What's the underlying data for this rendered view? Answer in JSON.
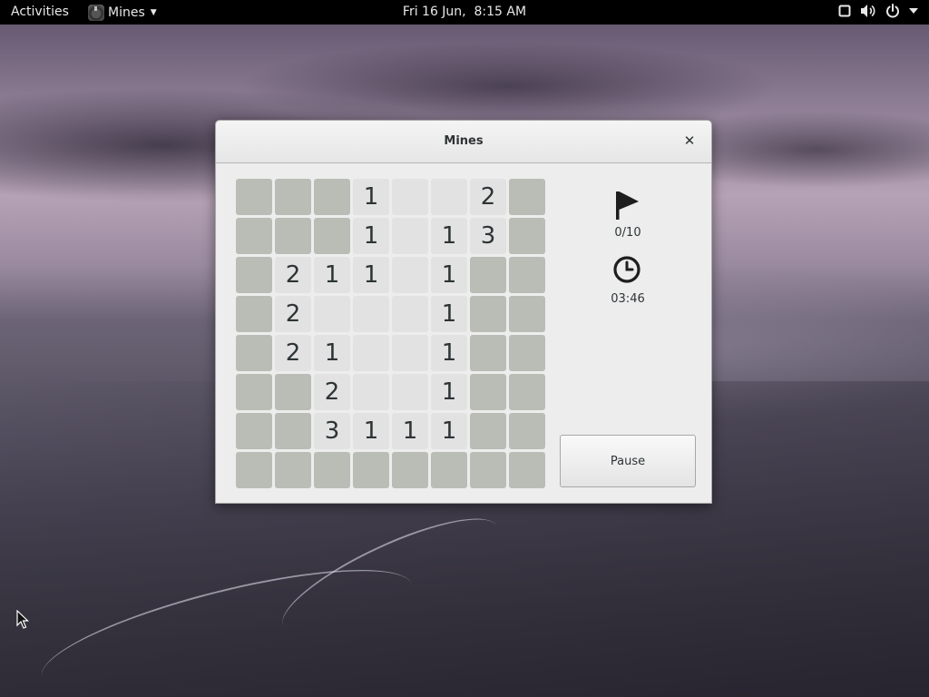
{
  "topbar": {
    "activities_label": "Activities",
    "app_name": "Mines",
    "clock": "Fri 16 Jun,  8:15 AM",
    "tray_icons": [
      "window-icon",
      "volume-icon",
      "power-icon",
      "chevron-down-icon"
    ]
  },
  "window": {
    "title": "Mines",
    "close_symbol": "✕"
  },
  "grid": {
    "columns": 8,
    "rows": [
      [
        {
          "s": "covered",
          "v": ""
        },
        {
          "s": "covered",
          "v": ""
        },
        {
          "s": "covered",
          "v": ""
        },
        {
          "s": "cleared",
          "v": "1"
        },
        {
          "s": "cleared",
          "v": ""
        },
        {
          "s": "cleared",
          "v": ""
        },
        {
          "s": "cleared",
          "v": "2"
        },
        {
          "s": "covered",
          "v": ""
        }
      ],
      [
        {
          "s": "covered",
          "v": ""
        },
        {
          "s": "covered",
          "v": ""
        },
        {
          "s": "covered",
          "v": ""
        },
        {
          "s": "cleared",
          "v": "1"
        },
        {
          "s": "cleared",
          "v": ""
        },
        {
          "s": "cleared",
          "v": "1"
        },
        {
          "s": "cleared",
          "v": "3"
        },
        {
          "s": "covered",
          "v": ""
        }
      ],
      [
        {
          "s": "covered",
          "v": ""
        },
        {
          "s": "cleared",
          "v": "2"
        },
        {
          "s": "cleared",
          "v": "1"
        },
        {
          "s": "cleared",
          "v": "1"
        },
        {
          "s": "cleared",
          "v": ""
        },
        {
          "s": "cleared",
          "v": "1"
        },
        {
          "s": "covered",
          "v": ""
        },
        {
          "s": "covered",
          "v": ""
        }
      ],
      [
        {
          "s": "covered",
          "v": ""
        },
        {
          "s": "cleared",
          "v": "2"
        },
        {
          "s": "cleared",
          "v": ""
        },
        {
          "s": "cleared",
          "v": ""
        },
        {
          "s": "cleared",
          "v": ""
        },
        {
          "s": "cleared",
          "v": "1"
        },
        {
          "s": "covered",
          "v": ""
        },
        {
          "s": "covered",
          "v": ""
        }
      ],
      [
        {
          "s": "covered",
          "v": ""
        },
        {
          "s": "cleared",
          "v": "2"
        },
        {
          "s": "cleared",
          "v": "1"
        },
        {
          "s": "cleared",
          "v": ""
        },
        {
          "s": "cleared",
          "v": ""
        },
        {
          "s": "cleared",
          "v": "1"
        },
        {
          "s": "covered",
          "v": ""
        },
        {
          "s": "covered",
          "v": ""
        }
      ],
      [
        {
          "s": "covered",
          "v": ""
        },
        {
          "s": "covered",
          "v": ""
        },
        {
          "s": "cleared",
          "v": "2"
        },
        {
          "s": "cleared",
          "v": ""
        },
        {
          "s": "cleared",
          "v": ""
        },
        {
          "s": "cleared",
          "v": "1"
        },
        {
          "s": "covered",
          "v": ""
        },
        {
          "s": "covered",
          "v": ""
        }
      ],
      [
        {
          "s": "covered",
          "v": ""
        },
        {
          "s": "covered",
          "v": ""
        },
        {
          "s": "cleared",
          "v": "3"
        },
        {
          "s": "cleared",
          "v": "1"
        },
        {
          "s": "cleared",
          "v": "1"
        },
        {
          "s": "cleared",
          "v": "1"
        },
        {
          "s": "covered",
          "v": ""
        },
        {
          "s": "covered",
          "v": ""
        }
      ],
      [
        {
          "s": "covered",
          "v": ""
        },
        {
          "s": "covered",
          "v": ""
        },
        {
          "s": "covered",
          "v": ""
        },
        {
          "s": "covered",
          "v": ""
        },
        {
          "s": "covered",
          "v": ""
        },
        {
          "s": "covered",
          "v": ""
        },
        {
          "s": "covered",
          "v": ""
        },
        {
          "s": "covered",
          "v": ""
        }
      ]
    ]
  },
  "status": {
    "flags": "0/10",
    "time": "03:46"
  },
  "pause_label": "Pause",
  "colors": {
    "covered_tile": "#babdb6",
    "cleared_tile": "#e2e2e2",
    "number_text": "#2e3436"
  }
}
